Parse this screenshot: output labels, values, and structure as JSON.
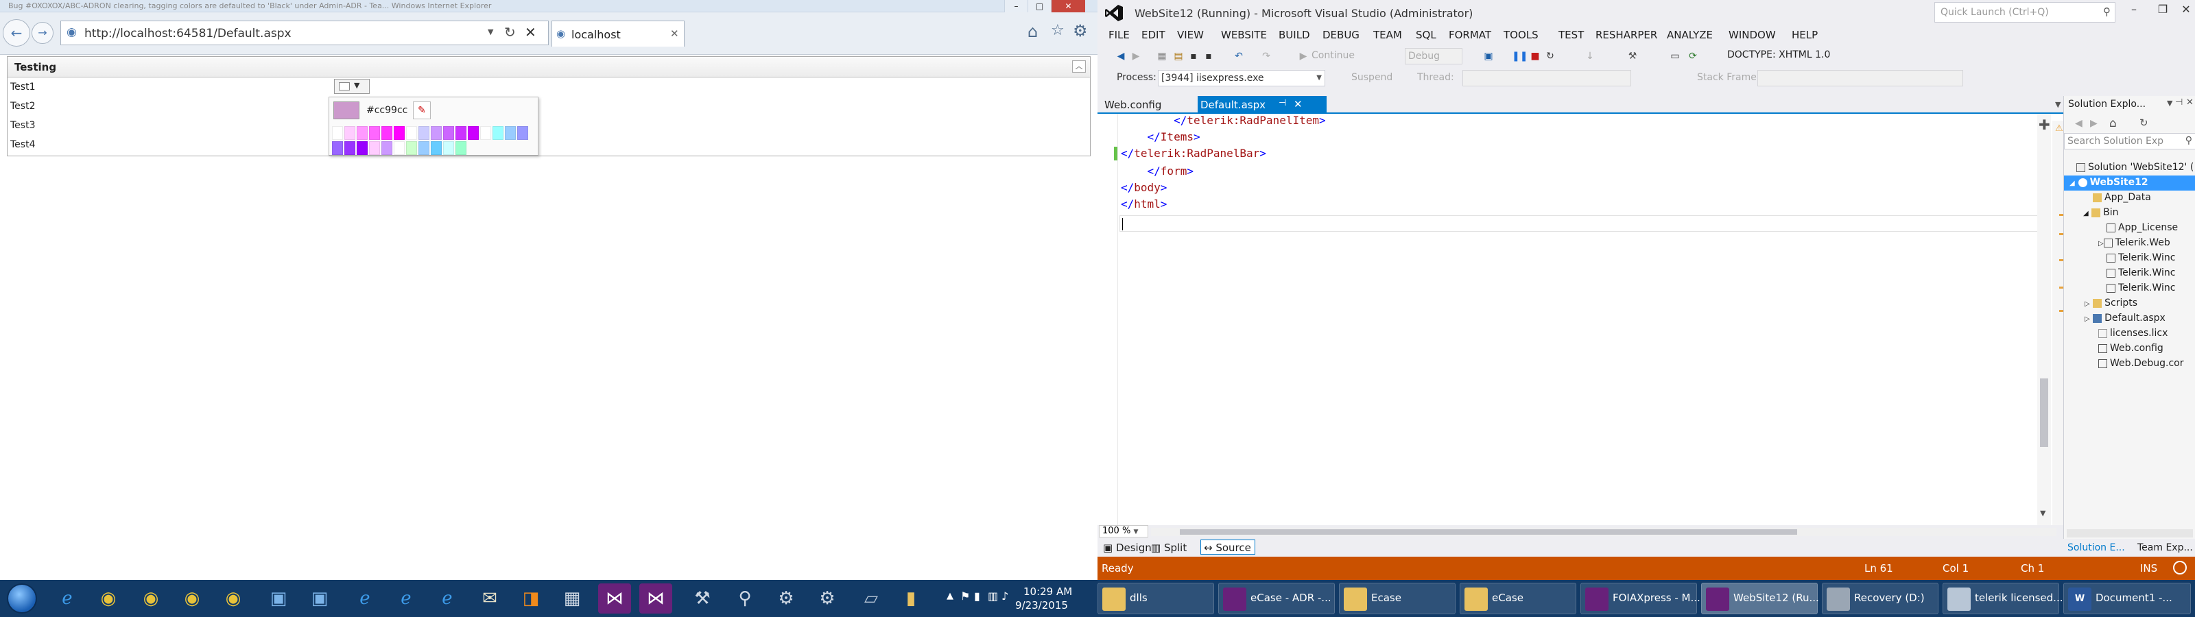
{
  "ie": {
    "window_title": "Bug #OXOXOX/ABC-ADRON clearing, tagging colors are defaulted to 'Black' under Admin-ADR - Tea... Windows Internet Explorer",
    "address": "http://localhost:64581/Default.aspx",
    "tab_title": "localhost",
    "panel": {
      "title": "Testing",
      "items": [
        "Test1",
        "Test2",
        "Test3",
        "Test4"
      ]
    },
    "colorpicker": {
      "hex": "#cc99cc",
      "palette": [
        "#ffffff",
        "#ffccff",
        "#ff99ff",
        "#ff66ff",
        "#ff33ff",
        "#ff00ff",
        "#ffffff",
        "#ccccff",
        "#cc99ff",
        "#cc66ff",
        "#cc33ff",
        "#cc00ff",
        "#ffffff",
        "#99ffff",
        "#99ccff",
        "#9999ff",
        "#9966ff",
        "#9933ff",
        "#9900ff",
        "#ffccff",
        "#cc99ff",
        "#ffffff",
        "#ccffcc",
        "#99ccff",
        "#66ccff",
        "#ccffff",
        "#99ffcc"
      ]
    }
  },
  "vs": {
    "title": "WebSite12 (Running) - Microsoft Visual Studio (Administrator)",
    "quick_launch": "Quick Launch (Ctrl+Q)",
    "menu": [
      "FILE",
      "EDIT",
      "VIEW",
      "WEBSITE",
      "BUILD",
      "DEBUG",
      "TEAM",
      "SQL",
      "FORMAT",
      "TOOLS",
      "TEST",
      "RESHARPER",
      "ANALYZE",
      "WINDOW",
      "HELP"
    ],
    "toolbar": {
      "continue": "Continue",
      "debug": "Debug",
      "doctype": "DOCTYPE: XHTML 1.0",
      "process_label": "Process:",
      "process_value": "[3944] iisexpress.exe",
      "suspend": "Suspend",
      "thread": "Thread:",
      "stack_frame": "Stack Frame:"
    },
    "tabs": {
      "webconfig": "Web.config",
      "default": "Default.aspx"
    },
    "code": [
      {
        "indent": "        ",
        "open": "</",
        "tag": "telerik:RadPanelItem",
        "close": ">"
      },
      {
        "indent": "    ",
        "open": "</",
        "tag": "Items",
        "close": ">"
      },
      {
        "indent": "",
        "open": "</",
        "tag": "telerik:RadPanelBar",
        "close": ">"
      },
      {
        "indent": "    ",
        "open": "</",
        "tag": "form",
        "close": ">"
      },
      {
        "indent": "",
        "open": "</",
        "tag": "body",
        "close": ">"
      },
      {
        "indent": "",
        "open": "</",
        "tag": "html",
        "close": ">"
      }
    ],
    "zoom": "100 %",
    "view_tabs": {
      "design": "Design",
      "split": "Split",
      "source": "Source"
    },
    "solution_explorer": {
      "title": "Solution Explo...",
      "search": "Search Solution Exp",
      "nodes": [
        "Solution 'WebSite12' (",
        "WebSite12",
        "App_Data",
        "Bin",
        "App_License",
        "Telerik.Web",
        "Telerik.Winc",
        "Telerik.Winc",
        "Telerik.Winc",
        "Scripts",
        "Default.aspx",
        "licenses.licx",
        "Web.config",
        "Web.Debug.cor"
      ],
      "bottom_tabs": [
        "Solution E...",
        "Team Exp..."
      ]
    },
    "status": {
      "ready": "Ready",
      "ln": "Ln 61",
      "col": "Col 1",
      "ch": "Ch 1",
      "ins": "INS"
    }
  },
  "taskbar": {
    "time": "10:29 AM",
    "date": "9/23/2015",
    "windows": [
      "dlls",
      "eCase - ADR -...",
      "Ecase",
      "eCase",
      "FOIAXpress - M...",
      "WebSite12 (Ru...",
      "Recovery (D:)",
      "telerik licensed...",
      "Document1 -..."
    ]
  },
  "colors": {
    "vs_accent": "#007acc",
    "vs_status": "#ca5100",
    "taskbar": "#123a66"
  }
}
